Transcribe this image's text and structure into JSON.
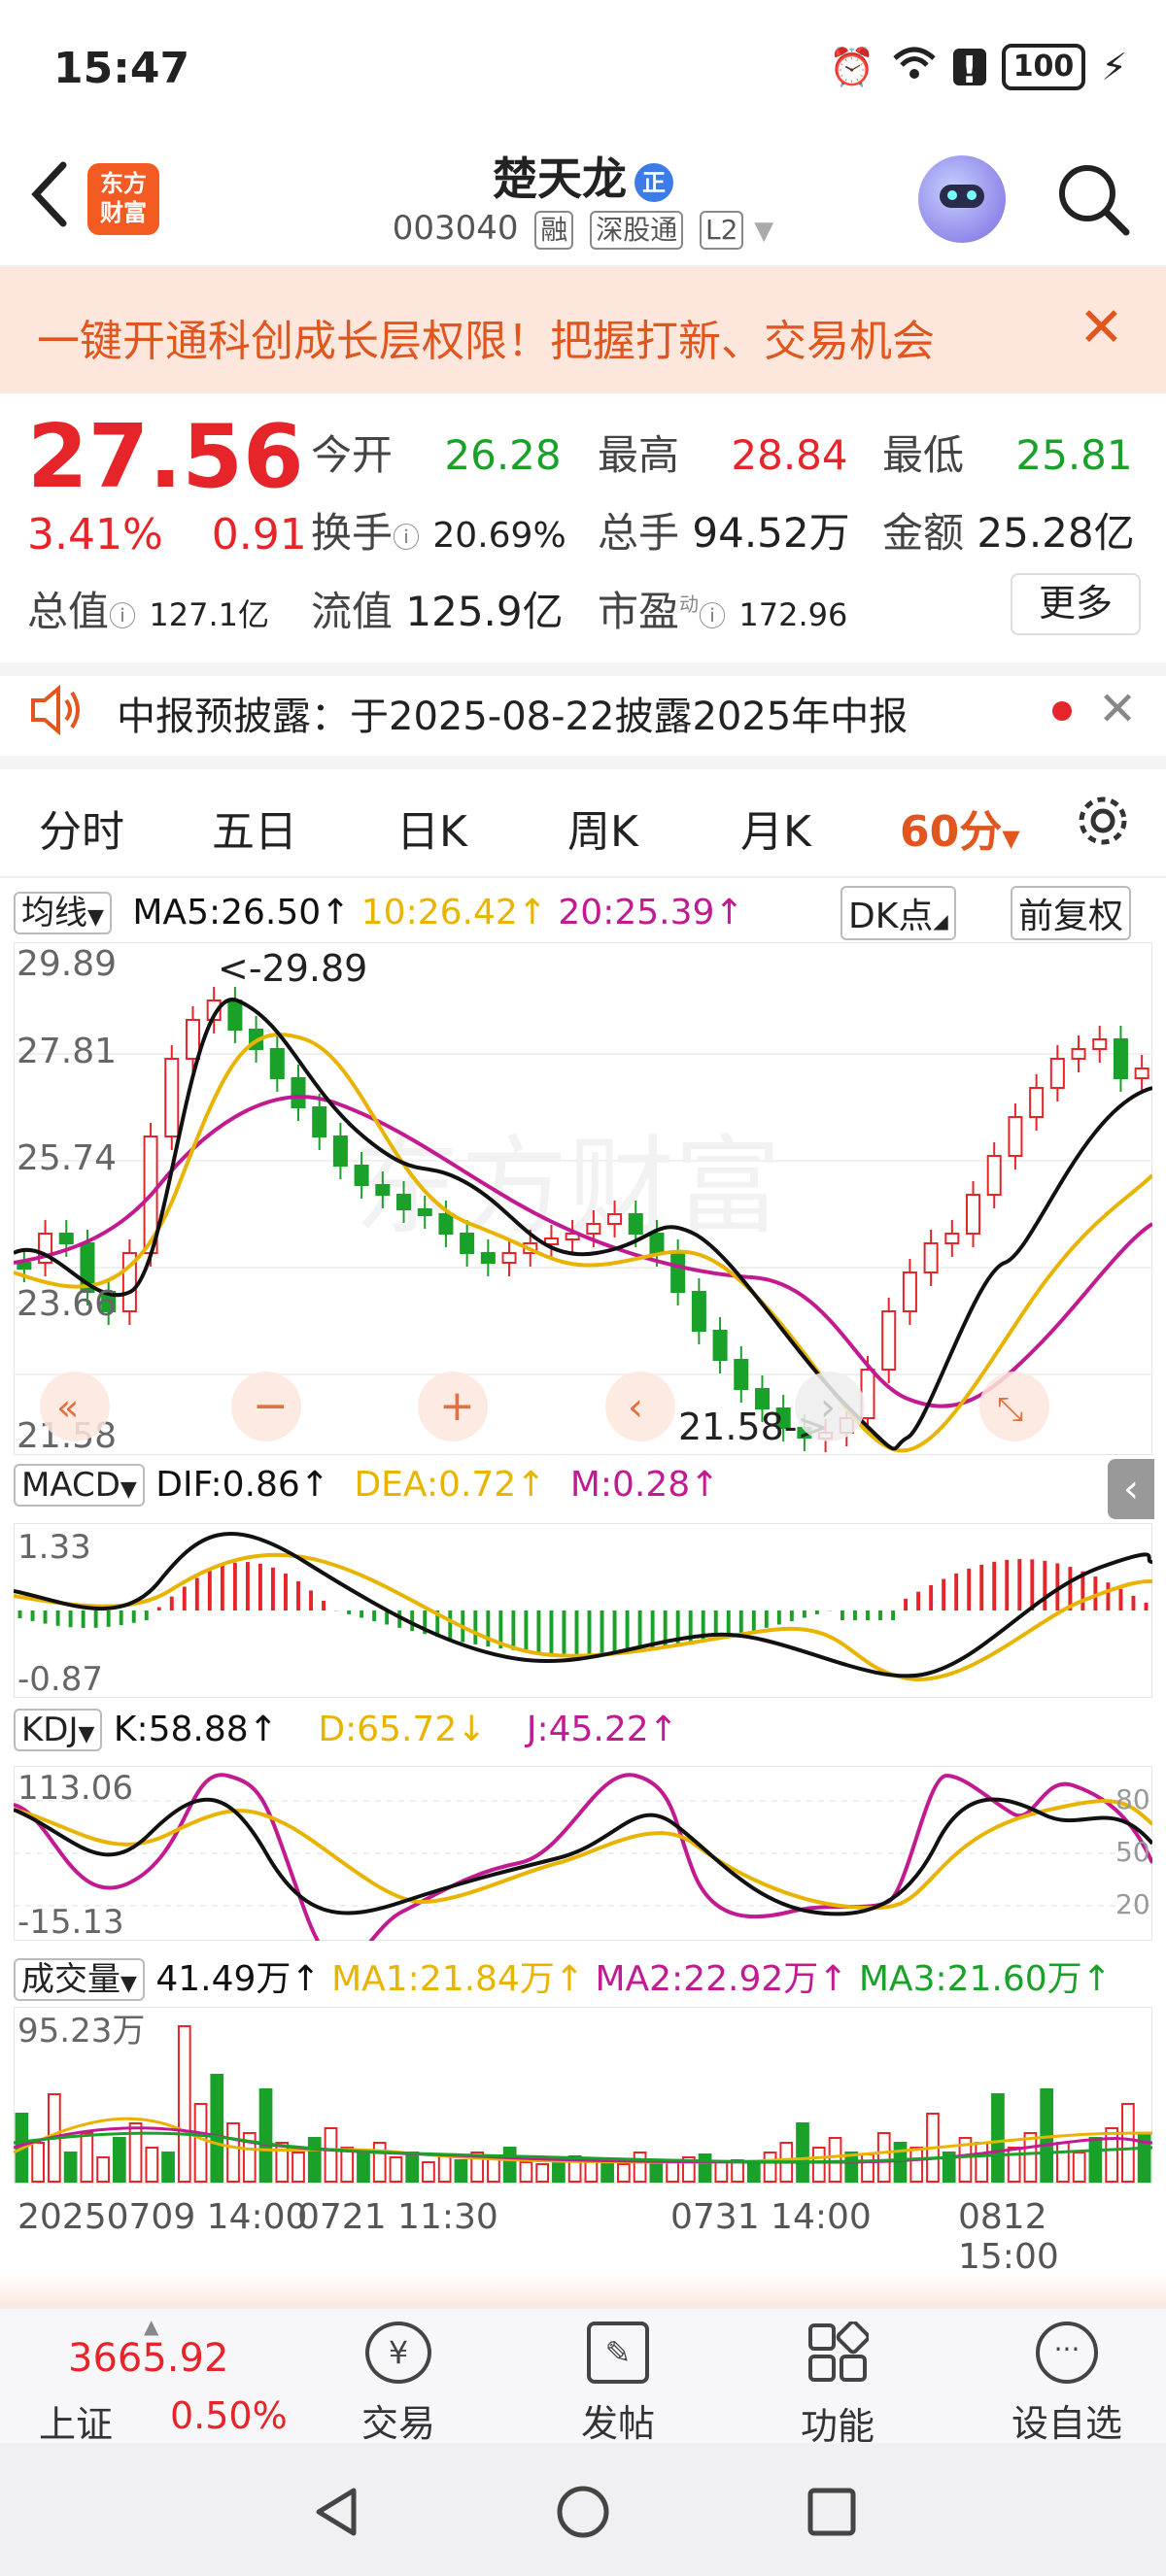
{
  "status": {
    "time": "15:47",
    "battery": "100"
  },
  "header": {
    "logo_line1": "东方",
    "logo_line2": "财富",
    "stock_name": "楚天龙",
    "name_badge": "正",
    "code": "003040",
    "tags": [
      "融",
      "深股通",
      "L2"
    ]
  },
  "banner": {
    "text": "一键开通科创成长层权限！把握打新、交易机会"
  },
  "quote": {
    "price": "27.56",
    "change_pct": "3.41%",
    "change_amt": "0.91",
    "open_label": "今开",
    "open": "26.28",
    "high_label": "最高",
    "high": "28.84",
    "low_label": "最低",
    "low": "25.81",
    "turnover_label": "换手",
    "turnover": "20.69%",
    "volume_label": "总手",
    "volume": "94.52万",
    "amount_label": "金额",
    "amount": "25.28亿",
    "total_cap_label": "总值",
    "total_cap": "127.1亿",
    "float_cap_label": "流值",
    "float_cap": "125.9亿",
    "pe_label": "市盈",
    "pe_sup": "动",
    "pe": "172.96",
    "more_label": "更多"
  },
  "notice": {
    "text": "中报预披露：于2025-08-22披露2025年中报"
  },
  "tabs": [
    "分时",
    "五日",
    "日K",
    "周K",
    "月K",
    "60分"
  ],
  "active_tab": "60分",
  "main_chart": {
    "selector": "均线",
    "ma5": "MA5:26.50↑",
    "ma10": "10:26.42↑",
    "ma20": "20:25.39↑",
    "dk_button": "DK点",
    "adjust_button": "前复权",
    "y_labels": [
      "29.89",
      "27.81",
      "25.74",
      "23.66",
      "21.58"
    ],
    "high_mark": "<-29.89",
    "low_mark": "21.58->",
    "watermark": "东方财富"
  },
  "macd": {
    "selector": "MACD",
    "dif": "DIF:0.86↑",
    "dea": "DEA:0.72↑",
    "m": "M:0.28↑",
    "y_top": "1.33",
    "y_bottom": "-0.87"
  },
  "kdj": {
    "selector": "KDJ",
    "k": "K:58.88↑",
    "d": "D:65.72↓",
    "j": "J:45.22↑",
    "y_top": "113.06",
    "y_bottom": "-15.13",
    "ref_80": "80",
    "ref_50": "50",
    "ref_20": "20"
  },
  "volume": {
    "selector": "成交量",
    "value": "41.49万↑",
    "ma1": "MA1:21.84万↑",
    "ma2": "MA2:22.92万↑",
    "ma3": "MA3:21.60万↑",
    "y_top": "95.23万"
  },
  "x_axis": [
    "20250709 14:00",
    "0721 11:30",
    "0731 14:00",
    "0812 15:00"
  ],
  "bottom_nav": {
    "index_value": "3665.92",
    "index_name": "上证",
    "index_change": "0.50%",
    "items": [
      "交易",
      "发帖",
      "功能",
      "设自选"
    ]
  },
  "colors": {
    "up": "#e5252a",
    "down": "#1aa12a",
    "accent": "#e0561e",
    "ma5": "#111111",
    "ma10": "#e8b400",
    "ma20": "#c21a90"
  }
}
